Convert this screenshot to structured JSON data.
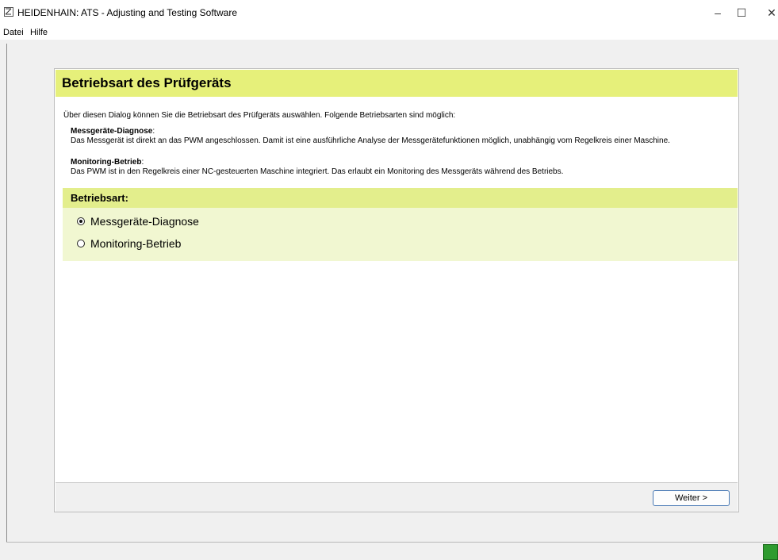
{
  "window": {
    "title": "HEIDENHAIN: ATS - Adjusting and Testing Software",
    "controls": {
      "minimize": "–",
      "maximize": "☐",
      "close": "✕"
    }
  },
  "menu": {
    "items": [
      "Datei",
      "Hilfe"
    ]
  },
  "dialog": {
    "title": "Betriebsart des Prüfgeräts",
    "intro": "Über diesen Dialog können Sie die Betriebsart des Prüfgeräts auswählen. Folgende Betriebsarten sind möglich:",
    "options_info": [
      {
        "title": "Messgeräte-Diagnose",
        "colon": ":",
        "description": "Das Messgerät ist direkt an das PWM angeschlossen. Damit ist eine ausführliche Analyse der Messgerätefunktionen möglich, unabhängig vom Regelkreis einer Maschine."
      },
      {
        "title": "Monitoring-Betrieb",
        "colon": ":",
        "description": "Das PWM ist in den Regelkreis einer NC-gesteuerten Maschine integriert. Das erlaubt ein Monitoring des Messgeräts während des Betriebs."
      }
    ],
    "section_title": "Betriebsart:",
    "radio_options": [
      {
        "label": "Messgeräte-Diagnose",
        "selected": true
      },
      {
        "label": "Monitoring-Betrieb",
        "selected": false
      }
    ],
    "next_button": "Weiter >"
  },
  "colors": {
    "header_bg": "#e6f07a",
    "section_bg": "#e3ee8c",
    "radio_panel_bg": "#f1f7d1",
    "status_icon": "#2f9b2f"
  }
}
